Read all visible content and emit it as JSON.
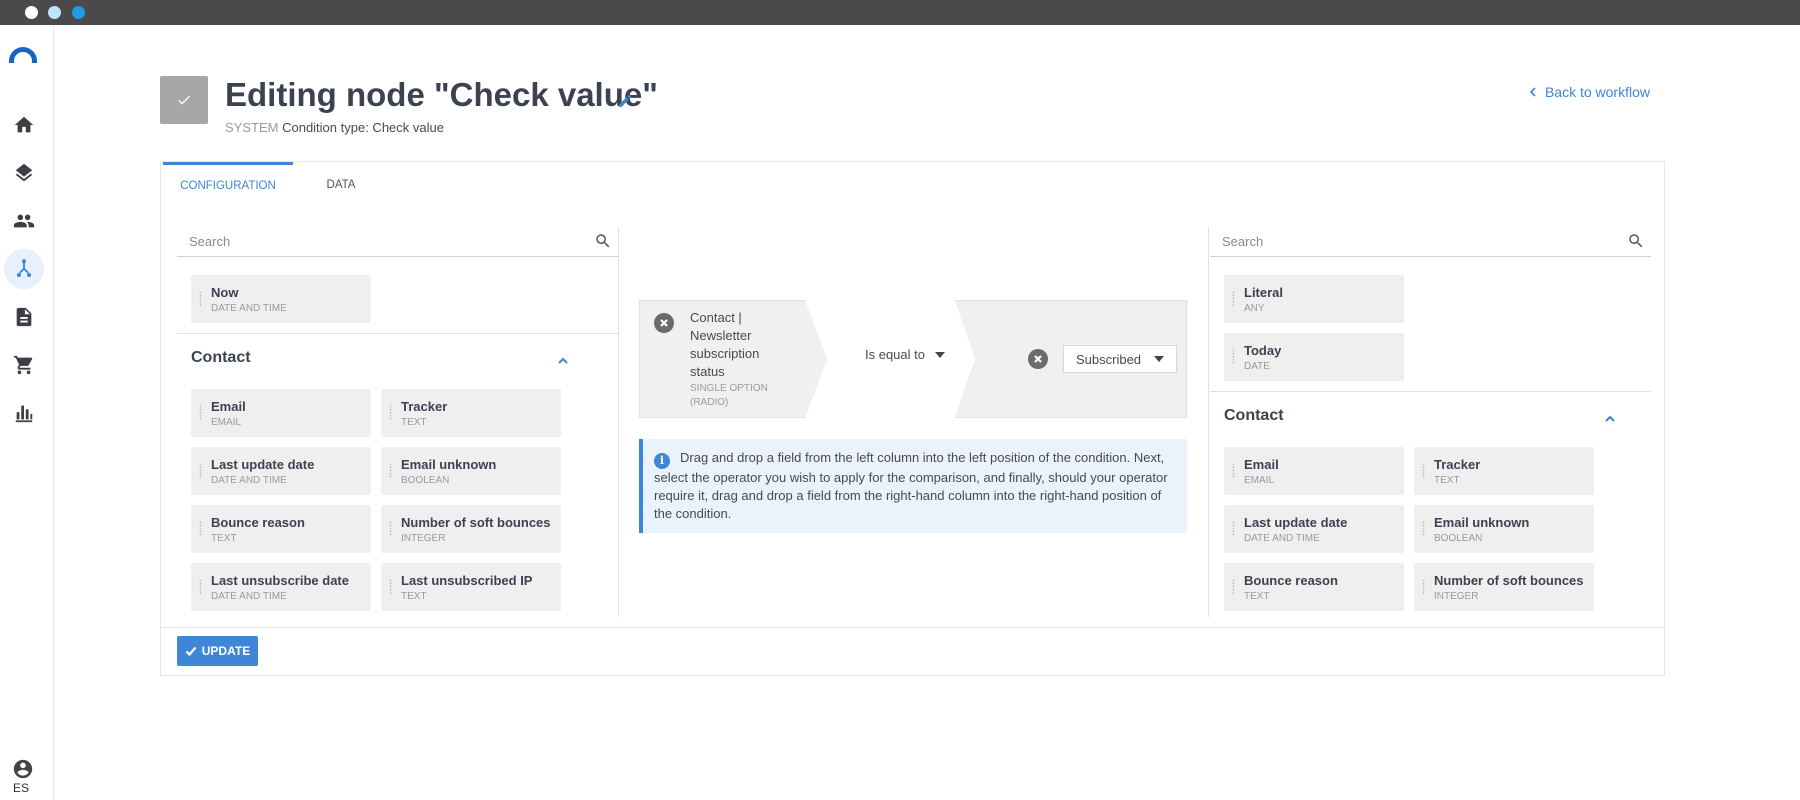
{
  "window": {
    "traffic_lights": [
      "#ffffff",
      "#bfe3f8",
      "#1e9be9"
    ]
  },
  "sidebar": {
    "items": [
      {
        "icon": "home-icon",
        "active": false
      },
      {
        "icon": "layers-icon",
        "active": false
      },
      {
        "icon": "people-icon",
        "active": false
      },
      {
        "icon": "workflow-icon",
        "active": true
      },
      {
        "icon": "document-icon",
        "active": false
      },
      {
        "icon": "cart-icon",
        "active": false
      },
      {
        "icon": "bar-chart-icon",
        "active": false
      }
    ],
    "user_icon": "user-circle-icon",
    "language": "ES"
  },
  "header": {
    "title": "Editing node \"Check value\"",
    "system_label": "SYSTEM",
    "condition_type": "Condition type: Check value",
    "back_link": "Back to workflow"
  },
  "tabs": [
    {
      "label": "CONFIGURATION",
      "active": true
    },
    {
      "label": "DATA",
      "active": false
    }
  ],
  "left_column": {
    "search_placeholder": "Search",
    "top_fields": [
      {
        "name": "Now",
        "type": "DATE AND TIME"
      }
    ],
    "group_title": "Contact",
    "fields": [
      {
        "name": "Email",
        "type": "EMAIL"
      },
      {
        "name": "Tracker",
        "type": "TEXT"
      },
      {
        "name": "Last update date",
        "type": "DATE AND TIME"
      },
      {
        "name": "Email unknown",
        "type": "BOOLEAN"
      },
      {
        "name": "Bounce reason",
        "type": "TEXT"
      },
      {
        "name": "Number of soft bounces",
        "type": "INTEGER"
      },
      {
        "name": "Last unsubscribe date",
        "type": "DATE AND TIME"
      },
      {
        "name": "Last unsubscribed IP",
        "type": "TEXT"
      }
    ]
  },
  "condition": {
    "left_field_name": "Contact | Newsletter subscription status",
    "left_field_type": "SINGLE OPTION (RADIO)",
    "operator": "Is equal to",
    "right_value": "Subscribed"
  },
  "info": {
    "text": "Drag and drop a field from the left column into the left position of the condition. Next, select the operator you wish to apply for the comparison, and finally, should your operator require it, drag and drop a field from the right-hand column into the right-hand position of the condition."
  },
  "right_column": {
    "search_placeholder": "Search",
    "top_fields": [
      {
        "name": "Literal",
        "type": "ANY"
      },
      {
        "name": "Today",
        "type": "DATE"
      }
    ],
    "group_title": "Contact",
    "fields": [
      {
        "name": "Email",
        "type": "EMAIL"
      },
      {
        "name": "Tracker",
        "type": "TEXT"
      },
      {
        "name": "Last update date",
        "type": "DATE AND TIME"
      },
      {
        "name": "Email unknown",
        "type": "BOOLEAN"
      },
      {
        "name": "Bounce reason",
        "type": "TEXT"
      },
      {
        "name": "Number of soft bounces",
        "type": "INTEGER"
      }
    ]
  },
  "footer": {
    "update_label": "UPDATE"
  }
}
